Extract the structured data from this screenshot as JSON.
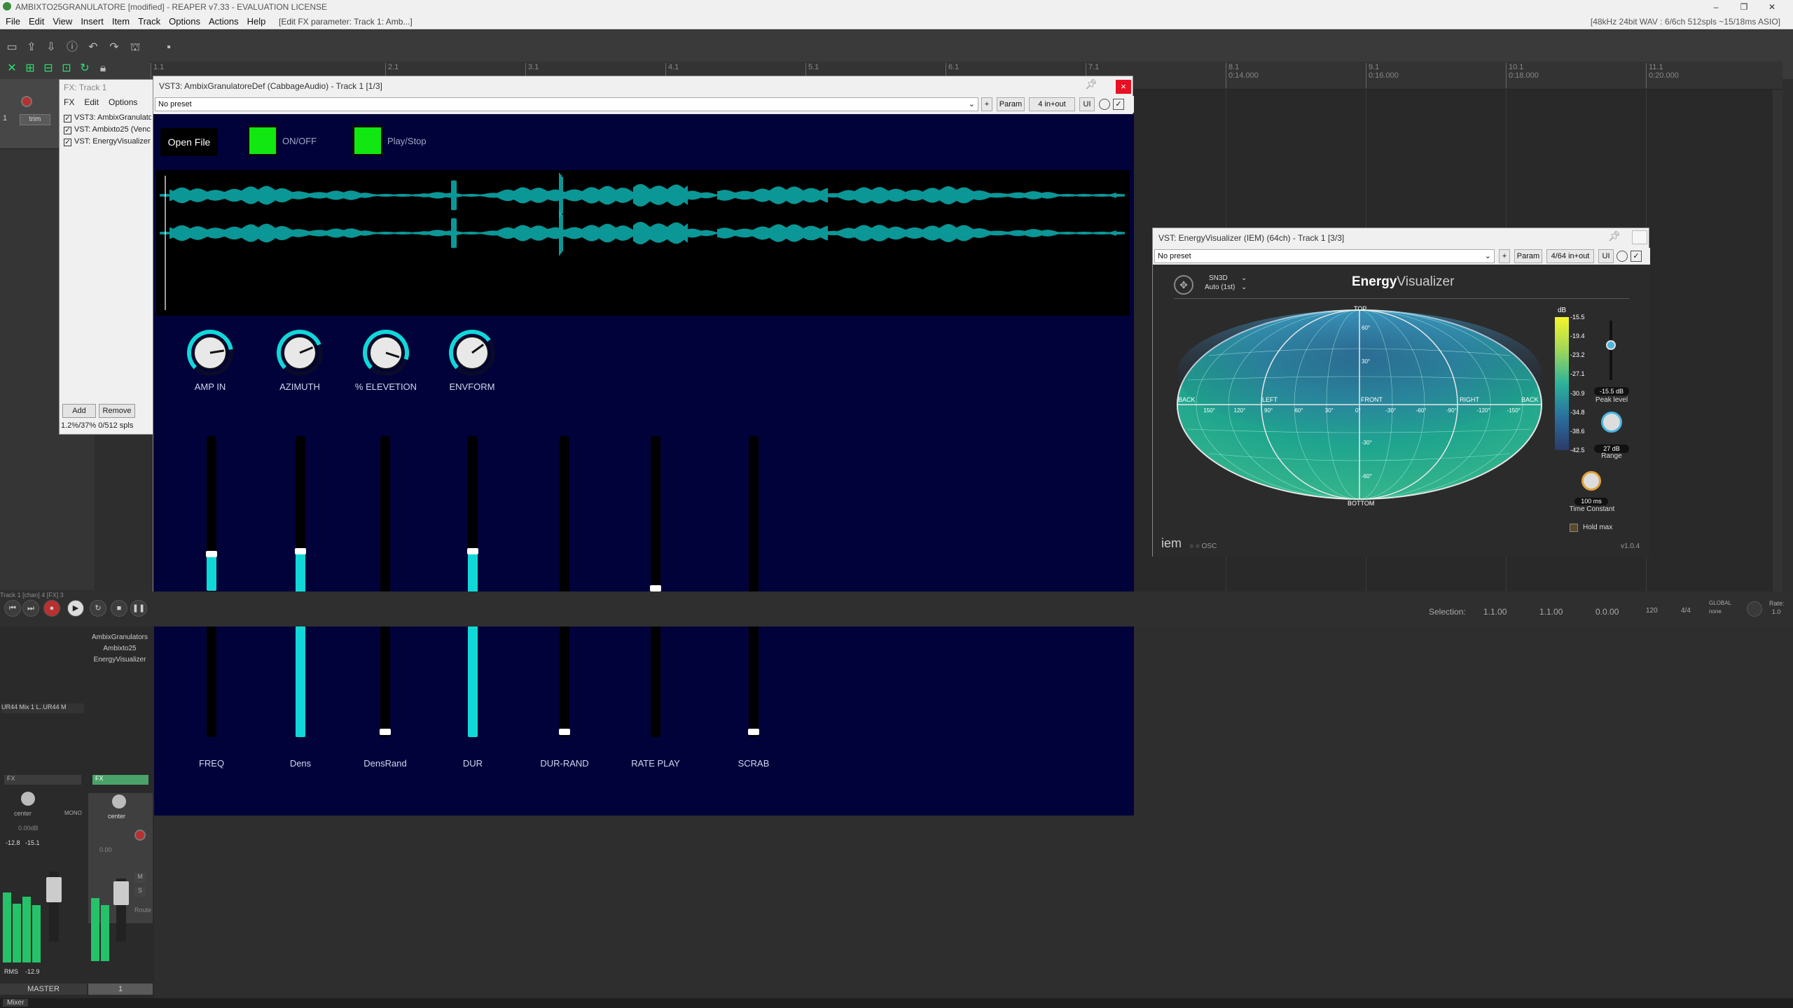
{
  "app": {
    "title": "AMBIXTO25GRANULATORE [modified] - REAPER v7.33 - EVALUATION LICENSE",
    "audio_info": "[48kHz 24bit WAV : 6/6ch 512spls ~15/18ms ASIO]",
    "edit_param": "[Edit FX parameter: Track 1: Amb...]"
  },
  "menu": [
    "File",
    "Edit",
    "View",
    "Insert",
    "Item",
    "Track",
    "Options",
    "Actions",
    "Help"
  ],
  "ruler": [
    {
      "label": "1.1"
    },
    {
      "label": "2.1"
    },
    {
      "label": "3.1"
    },
    {
      "label": "4.1"
    },
    {
      "label": "5.1"
    },
    {
      "label": "6.1"
    },
    {
      "label": "7.1"
    },
    {
      "label": "8.1",
      "time": "0:14.000"
    },
    {
      "label": "9.1",
      "time": "0:16.000"
    },
    {
      "label": "10.1",
      "time": "0:18.000"
    },
    {
      "label": "11.1",
      "time": "0:20.000"
    }
  ],
  "fx_chain": {
    "title": "FX: Track 1",
    "menu": [
      "FX",
      "Edit",
      "Options"
    ],
    "items": [
      "VST3: AmbixGranulatore",
      "VST: Ambixto25 (Venc",
      "VST: EnergyVisualizer"
    ],
    "add": "Add",
    "remove": "Remove",
    "status": "1.2%/37% 0/512 spls"
  },
  "cabbage": {
    "title": "VST3: AmbixGranulatoreDef (CabbageAudio) - Track 1 [1/3]",
    "preset": "No preset",
    "plus": "+",
    "param": "Param",
    "io": "4 in+out",
    "ui": "UI",
    "close": "×",
    "open_file": "Open File",
    "onoff": "ON/OFF",
    "playstop": "Play/Stop",
    "knobs": [
      {
        "label": "AMP IN",
        "value": 0.8
      },
      {
        "label": "AZIMUTH",
        "value": 0.75
      },
      {
        "label": "% ELEVETION",
        "value": 0.9
      },
      {
        "label": "ENVFORM",
        "value": 0.7
      }
    ],
    "sliders": [
      {
        "label": "FREQ",
        "value": 0.62,
        "range_low": 0.49
      },
      {
        "label": "Dens",
        "value": 0.63
      },
      {
        "label": "DensRand",
        "value": 0.0
      },
      {
        "label": "DUR",
        "value": 0.63
      },
      {
        "label": "DUR-RAND",
        "value": 0.0
      },
      {
        "label": "RATE PLAY",
        "value": 0.5,
        "range_low": 0.49
      },
      {
        "label": "SCRAB",
        "value": 0.0
      }
    ]
  },
  "energy": {
    "title": "VST: EnergyVisualizer (IEM) (64ch) - Track 1 [3/3]",
    "preset": "No preset",
    "plus": "+",
    "param": "Param",
    "io": "4/64 in+out",
    "ui": "UI",
    "norm": "SN3D",
    "order": "Auto (1st)",
    "brand_bold": "Energy",
    "brand_light": "Visualizer",
    "labels": {
      "top": "TOP",
      "bottom": "BOTTOM",
      "back_l": "BACK",
      "left": "LEFT",
      "front": "FRONT",
      "right": "RIGHT",
      "back_r": "BACK"
    },
    "az_ticks": [
      "150°",
      "120°",
      "90°",
      "60°",
      "30°",
      "0°",
      "-30°",
      "-60°",
      "-90°",
      "-120°",
      "-150°"
    ],
    "el_ticks": [
      "60°",
      "30°",
      "-30°",
      "-60°"
    ],
    "db_title": "dB",
    "db_ticks": [
      "-15.5",
      "-19.4",
      "-23.2",
      "-27.1",
      "-30.9",
      "-34.8",
      "-38.6",
      "-42.5"
    ],
    "peak_value": "-15.5 dB",
    "peak_label": "Peak level",
    "range_value": "27 dB",
    "range_label": "Range",
    "time_value": "100 ms",
    "time_label": "Time Constant",
    "hold": "Hold max",
    "logo": "iem",
    "osc": "OSC",
    "version": "v1.0.4"
  },
  "transport": {
    "selection_label": "Selection:",
    "sel_start": "1.1.00",
    "sel_end": "1.1.00",
    "sel_len": "0.0.00",
    "bpm": "120",
    "sig": "4/4",
    "global": "GLOBAL",
    "none": "none",
    "rate": "Rate:",
    "rate_val": "1.0"
  },
  "mixer": {
    "track_info": "Track 1 [chan] 4 [FX] 3",
    "fx_list": [
      "AmbixGranulators",
      "Ambixto25",
      "EnergyVisualizer"
    ],
    "input": "UR44 Mix 1 L..UR44 M",
    "master_label": "MASTER",
    "track_label": "1",
    "master_pan": "center",
    "track_pan": "center",
    "master_vol": "0.00dB",
    "track_vol": "0.00",
    "peak_l": "-12.8",
    "peak_r": "-15.1",
    "rms": "RMS",
    "rms_val": "-12.9",
    "mono": "MONO",
    "fx": "FX",
    "route": "Route",
    "trim": "trim",
    "mixer_tab": "Mixer"
  },
  "colors": {
    "plugin_bg": "#02023a",
    "cyan": "#11d8d8",
    "green_btn": "#11e811",
    "reaper_green": "#2ee06f"
  }
}
